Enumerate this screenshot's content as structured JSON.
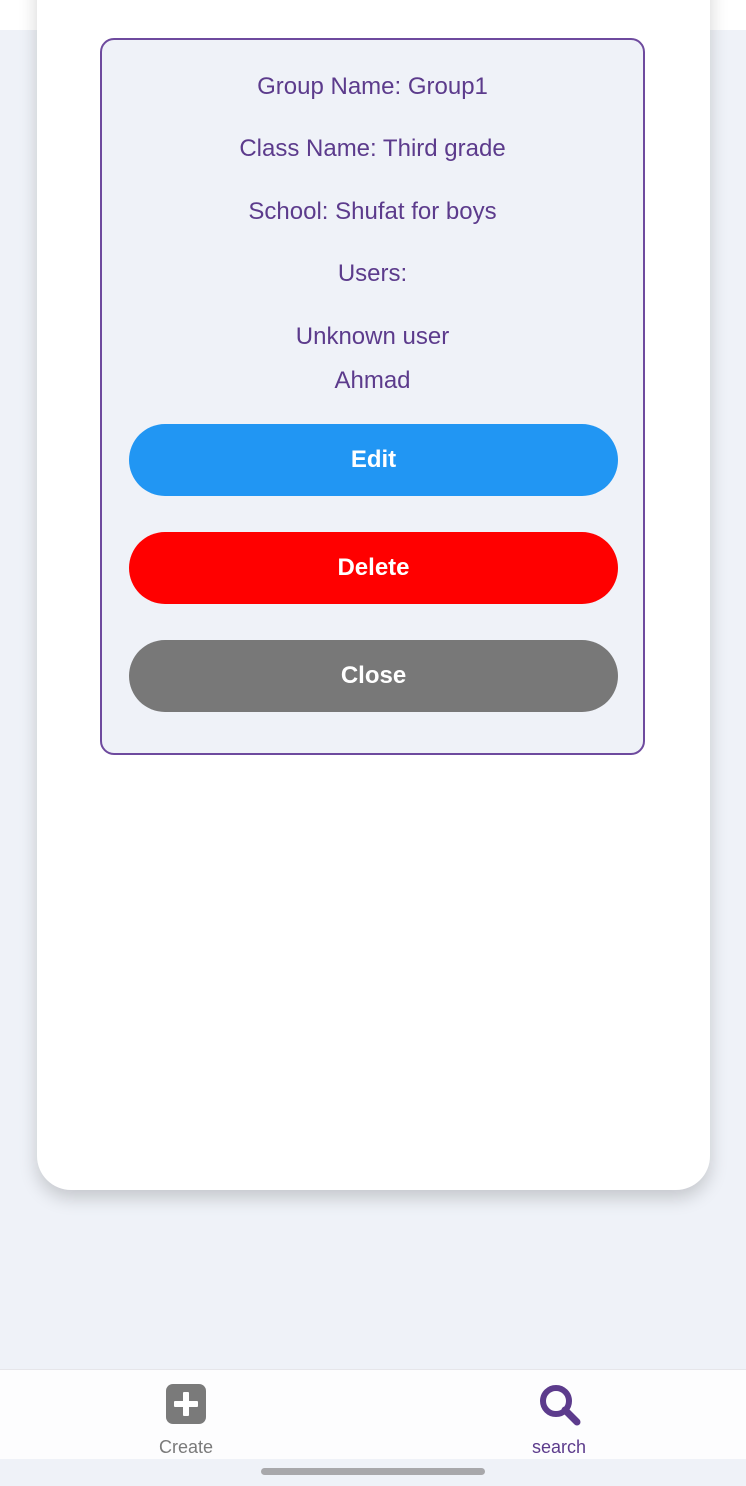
{
  "group_details": {
    "group_name": "Group Name: Group1",
    "class_name": "Class Name: Third grade",
    "school": "School: Shufat for boys",
    "users_heading": "Users:",
    "users": [
      "Unknown user",
      "Ahmad"
    ],
    "text_color": "#5c3b8c",
    "border_color": "#6e4a9e"
  },
  "buttons": {
    "edit": {
      "label": "Edit",
      "color": "#2196f3"
    },
    "delete": {
      "label": "Delete",
      "color": "#ff0000"
    },
    "close": {
      "label": "Close",
      "color": "#787878"
    }
  },
  "bottom_nav": {
    "items": [
      {
        "label": "Create",
        "icon": "plus-square-icon",
        "active": false,
        "color": "#7a7a7a"
      },
      {
        "label": "search",
        "icon": "search-icon",
        "active": true,
        "color": "#5c3b8c"
      }
    ]
  }
}
